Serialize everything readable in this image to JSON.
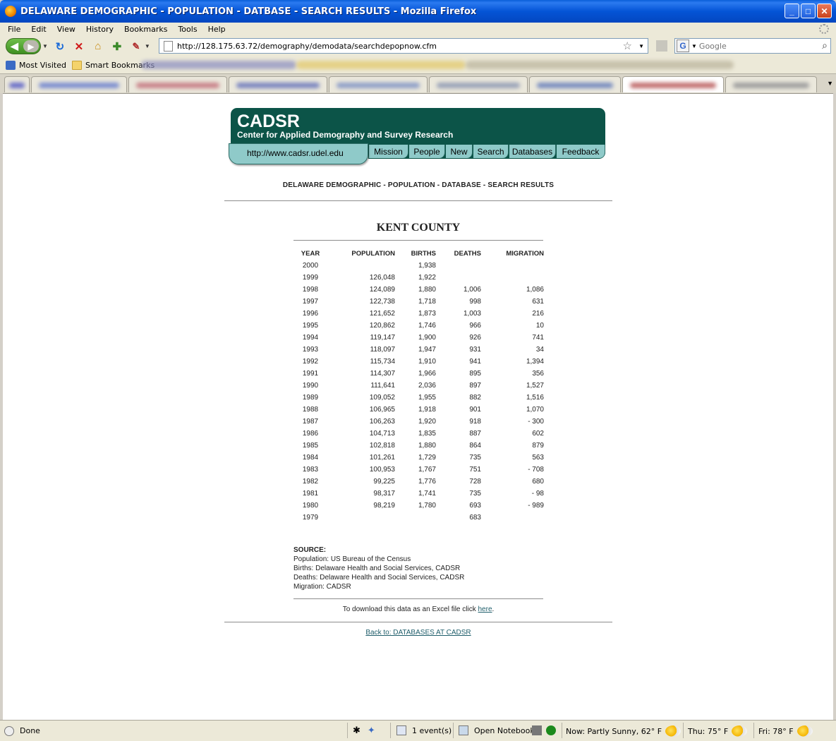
{
  "window": {
    "title": "DELAWARE DEMOGRAPHIC - POPULATION - DATBASE - SEARCH RESULTS - Mozilla Firefox",
    "buttons": {
      "minimize": "_",
      "maximize": "□",
      "close": "✕"
    }
  },
  "menu": [
    "File",
    "Edit",
    "View",
    "History",
    "Bookmarks",
    "Tools",
    "Help"
  ],
  "navbar": {
    "url": "http://128.175.63.72/demography/demodata/searchdepopnow.cfm",
    "search_placeholder": "Google"
  },
  "bookmarks": [
    {
      "label": "Most Visited",
      "icon": "most-visited-icon"
    },
    {
      "label": "Smart Bookmarks",
      "icon": "folder-icon"
    }
  ],
  "page": {
    "brand": "CADSR",
    "tagline": "Center for Applied Demography and Survey Research",
    "site_url": "http://www.cadsr.udel.edu",
    "nav": [
      "Mission",
      "People",
      "New",
      "Search",
      "Databases",
      "Feedback"
    ],
    "heading": "DELAWARE DEMOGRAPHIC - POPULATION - DATABASE - SEARCH RESULTS",
    "county": "KENT COUNTY",
    "columns": [
      "YEAR",
      "POPULATION",
      "BIRTHS",
      "DEATHS",
      "MIGRATION"
    ],
    "rows": [
      [
        "2000",
        "",
        "1,938",
        "",
        ""
      ],
      [
        "1999",
        "126,048",
        "1,922",
        "",
        ""
      ],
      [
        "1998",
        "124,089",
        "1,880",
        "1,006",
        "1,086"
      ],
      [
        "1997",
        "122,738",
        "1,718",
        "998",
        "631"
      ],
      [
        "1996",
        "121,652",
        "1,873",
        "1,003",
        "216"
      ],
      [
        "1995",
        "120,862",
        "1,746",
        "966",
        "10"
      ],
      [
        "1994",
        "119,147",
        "1,900",
        "926",
        "741"
      ],
      [
        "1993",
        "118,097",
        "1,947",
        "931",
        "34"
      ],
      [
        "1992",
        "115,734",
        "1,910",
        "941",
        "1,394"
      ],
      [
        "1991",
        "114,307",
        "1,966",
        "895",
        "356"
      ],
      [
        "1990",
        "111,641",
        "2,036",
        "897",
        "1,527"
      ],
      [
        "1989",
        "109,052",
        "1,955",
        "882",
        "1,516"
      ],
      [
        "1988",
        "106,965",
        "1,918",
        "901",
        "1,070"
      ],
      [
        "1987",
        "106,263",
        "1,920",
        "918",
        "- 300"
      ],
      [
        "1986",
        "104,713",
        "1,835",
        "887",
        "602"
      ],
      [
        "1985",
        "102,818",
        "1,880",
        "864",
        "879"
      ],
      [
        "1984",
        "101,261",
        "1,729",
        "735",
        "563"
      ],
      [
        "1983",
        "100,953",
        "1,767",
        "751",
        "- 708"
      ],
      [
        "1982",
        "99,225",
        "1,776",
        "728",
        "680"
      ],
      [
        "1981",
        "98,317",
        "1,741",
        "735",
        "- 98"
      ],
      [
        "1980",
        "98,219",
        "1,780",
        "693",
        "- 989"
      ],
      [
        "1979",
        "",
        "",
        "683",
        ""
      ]
    ],
    "source": {
      "label": "SOURCE:",
      "lines": [
        "Population: US Bureau of the Census",
        "Births: Delaware Health and Social Services, CADSR",
        "Deaths: Delaware Health and Social Services, CADSR",
        "Migration: CADSR"
      ]
    },
    "download_text": "To download this data as an Excel file click ",
    "download_link": "here",
    "download_suffix": ".",
    "back_link": "Back to: DATABASES AT CADSR"
  },
  "statusbar": {
    "status": "Done",
    "events": "1 event(s)",
    "notebook": "Open Notebook",
    "weather_now": "Now: Partly Sunny, 62° F",
    "weather_thu": "Thu: 75° F",
    "weather_fri": "Fri: 78° F"
  },
  "colors": {
    "banner": "#0c5448",
    "nav_button": "#8fcac9",
    "link": "#1f5e6b"
  }
}
